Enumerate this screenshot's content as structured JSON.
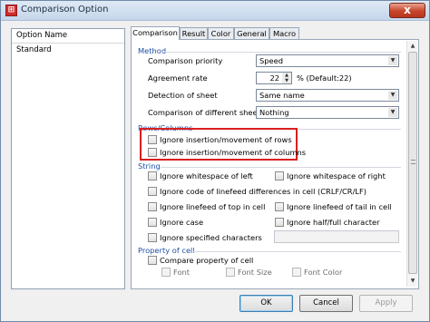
{
  "window": {
    "title": "Comparison Option",
    "close_glyph": "x",
    "icon_glyph": "⊞"
  },
  "left_panel": {
    "header": "Option Name",
    "items": [
      "Standard"
    ]
  },
  "tabs": [
    "Comparison",
    "Result",
    "Color",
    "General",
    "Macro"
  ],
  "method": {
    "title": "Method",
    "priority_label": "Comparison priority",
    "priority_value": "Speed",
    "agreement_label": "Agreement rate",
    "agreement_value": "22",
    "agreement_suffix": "% (Default:22)",
    "detection_label": "Detection of sheet",
    "detection_value": "Same name",
    "different_label": "Comparison of different sheet",
    "different_value": "Nothing"
  },
  "rows_columns": {
    "title": "Rows/Columns",
    "ignore_rows": "Ignore insertion/movement of rows",
    "ignore_columns": "Ignore insertion/movement of columns"
  },
  "string": {
    "title": "String",
    "ignore_ws_left": "Ignore whitespace of left",
    "ignore_ws_right": "Ignore whitespace of right",
    "ignore_linefeed_code": "Ignore code of linefeed differences in cell (CRLF/CR/LF)",
    "ignore_linefeed_top": "Ignore linefeed of top in cell",
    "ignore_linefeed_tail": "Ignore linefeed of tail in cell",
    "ignore_case": "Ignore case",
    "ignore_half_full": "Ignore half/full character",
    "ignore_specified": "Ignore specified characters"
  },
  "property": {
    "title": "Property of cell",
    "compare_property": "Compare property of cell",
    "font": "Font",
    "font_size": "Font Size",
    "font_color": "Font Color"
  },
  "buttons": {
    "ok": "OK",
    "cancel": "Cancel",
    "apply": "Apply"
  },
  "colors": {
    "section_blue": "#1f4fa7",
    "highlight_red": "#d81f1f"
  }
}
